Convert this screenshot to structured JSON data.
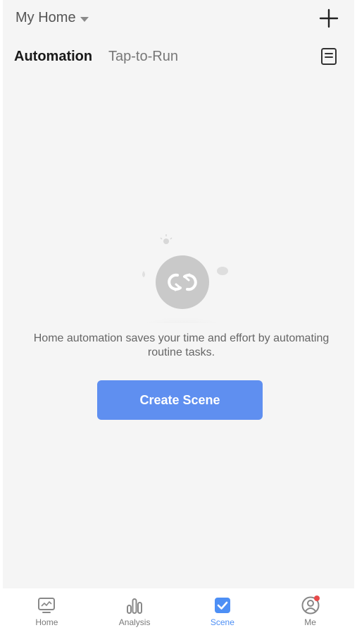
{
  "header": {
    "home_name": "My Home",
    "add_icon": "plus-icon"
  },
  "tabs": {
    "active": "Automation",
    "inactive": "Tap-to-Run",
    "log_icon": "document-icon"
  },
  "empty_state": {
    "illustration_icon": "automation-loop-icon",
    "message": "Home automation saves your time and effort by automating routine tasks.",
    "button_label": "Create Scene"
  },
  "bottom_nav": {
    "items": [
      {
        "label": "Home",
        "icon": "home-monitor-icon",
        "active": false
      },
      {
        "label": "Analysis",
        "icon": "bar-chart-icon",
        "active": false
      },
      {
        "label": "Scene",
        "icon": "checkbox-icon",
        "active": true
      },
      {
        "label": "Me",
        "icon": "user-profile-icon",
        "active": false,
        "badge": true
      }
    ]
  },
  "colors": {
    "accent": "#5f8ff0",
    "active_tab": "#4d8ff5",
    "badge": "#e84a4a",
    "background": "#f5f5f5"
  }
}
